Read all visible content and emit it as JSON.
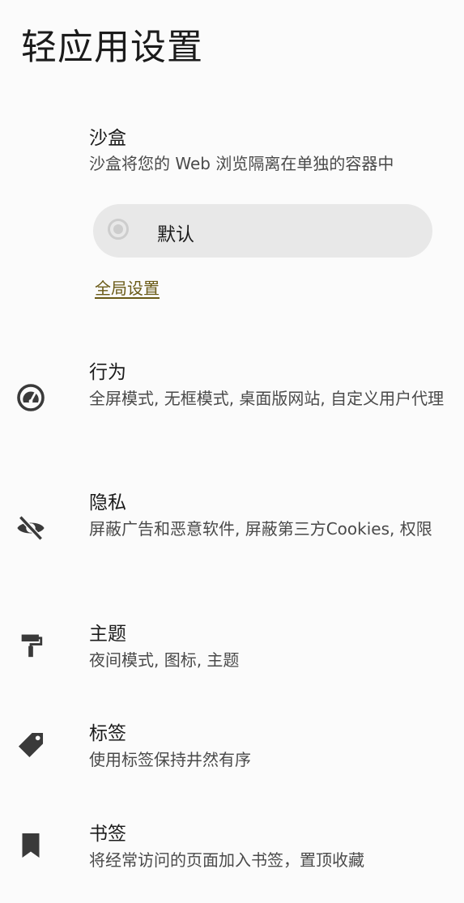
{
  "page": {
    "title": "轻应用设置"
  },
  "sandbox": {
    "title": "沙盒",
    "description": "沙盒将您的 Web 浏览隔离在单独的容器中",
    "option_label": "默认",
    "global_link": "全局设置"
  },
  "settings": [
    {
      "icon": "speedometer-icon",
      "title": "行为",
      "description": "全屏模式, 无框模式, 桌面版网站, 自定义用户代理"
    },
    {
      "icon": "eye-off-icon",
      "title": "隐私",
      "description": "屏蔽广告和恶意软件, 屏蔽第三方Cookies, 权限"
    },
    {
      "icon": "paint-roller-icon",
      "title": "主题",
      "description": "夜间模式, 图标, 主题"
    },
    {
      "icon": "tag-icon",
      "title": "标签",
      "description": "使用标签保持井然有序"
    },
    {
      "icon": "bookmark-icon",
      "title": "书签",
      "description": "将经常访问的页面加入书签，置顶收藏"
    }
  ]
}
